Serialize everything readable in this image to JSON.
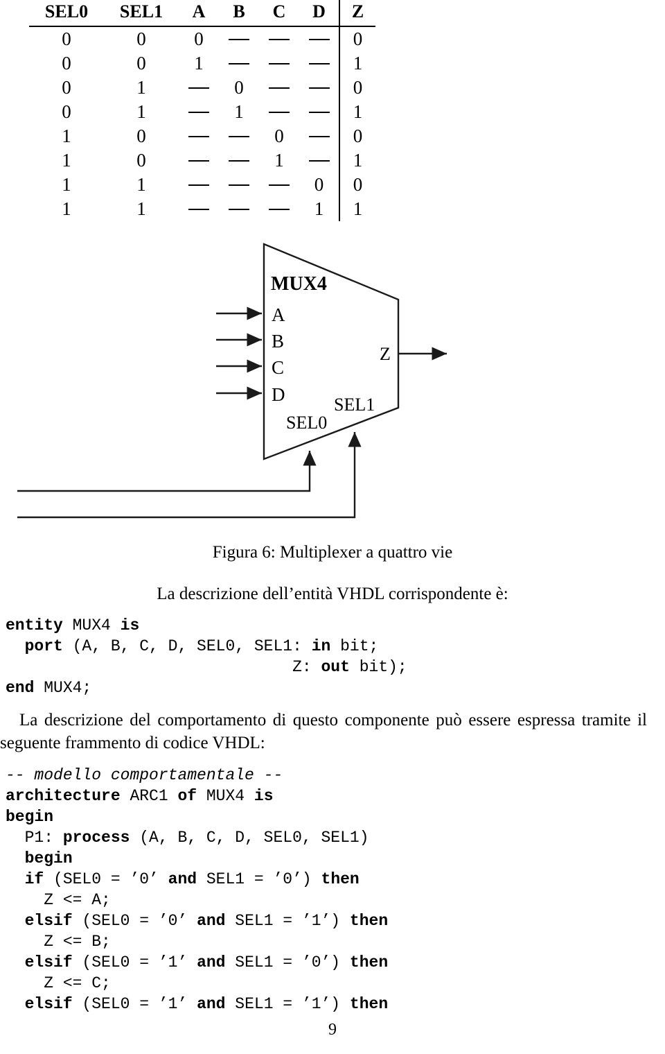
{
  "truth_table": {
    "headers": [
      "SEL0",
      "SEL1",
      "A",
      "B",
      "C",
      "D",
      "Z"
    ],
    "rows": [
      [
        "0",
        "0",
        "0",
        "—",
        "—",
        "—",
        "0"
      ],
      [
        "0",
        "0",
        "1",
        "—",
        "—",
        "—",
        "1"
      ],
      [
        "0",
        "1",
        "—",
        "0",
        "—",
        "—",
        "0"
      ],
      [
        "0",
        "1",
        "—",
        "1",
        "—",
        "—",
        "1"
      ],
      [
        "1",
        "0",
        "—",
        "—",
        "0",
        "—",
        "0"
      ],
      [
        "1",
        "0",
        "—",
        "—",
        "1",
        "—",
        "1"
      ],
      [
        "1",
        "1",
        "—",
        "—",
        "—",
        "0",
        "0"
      ],
      [
        "1",
        "1",
        "—",
        "—",
        "—",
        "1",
        "1"
      ]
    ]
  },
  "figure": {
    "block_label": "MUX4",
    "input_labels": [
      "A",
      "B",
      "C",
      "D"
    ],
    "output_label": "Z",
    "select_labels": [
      "SEL0",
      "SEL1"
    ],
    "caption": "Figura 6: Multiplexer a quattro vie"
  },
  "prose": {
    "entity_intro": "La descrizione dell’entità VHDL corrispondente è:",
    "behaviour_intro": "La descrizione del comportamento di questo componente può essere espressa tramite il seguente frammento di codice VHDL:"
  },
  "entity_code": {
    "line1_kw": "entity",
    "line1_name": " MUX4 ",
    "line1_kw2": "is",
    "line2_indent": "  ",
    "line2_kw": "port",
    "line2_args": " (A, B, C, D, SEL0, SEL1: ",
    "line2_kw2": "in",
    "line2_type": " bit;",
    "line3_indent": "                              ",
    "line3_sig": "Z: ",
    "line3_kw": "out",
    "line3_type": " bit);",
    "line4_kw": "end",
    "line4_name": " MUX4;"
  },
  "arch_code": {
    "comment": "-- modello comportamentale --",
    "l2_kw": "architecture",
    "l2_a": " ARC1 ",
    "l2_kw2": "of",
    "l2_b": " MUX4 ",
    "l2_kw3": "is",
    "l3_kw": "begin",
    "l4_indent": "  ",
    "l4_label": "P1: ",
    "l4_kw": "process",
    "l4_args": " (A, B, C, D, SEL0, SEL1)",
    "l5_indent": "  ",
    "l5_kw": "begin",
    "l6_indent": "  ",
    "l6_kw": "if",
    "l6_a": " (SEL0 = ",
    "l6_kw_and": "and",
    "l6_then": "then",
    "l7": "    Z <= A;",
    "l8_kw": "elsif",
    "l9": "    Z <= B;",
    "l10_kw": "elsif",
    "l11": "    Z <= C;",
    "l12_kw": "elsif",
    "q0": "’0’",
    "q1": "’1’",
    "mid_sel1": " SEL1 = ",
    "close_paren": ") ",
    "space": " "
  },
  "code_lines": {
    "if_00": [
      "if",
      " (SEL0 = ",
      "’0’",
      " ",
      "and",
      " SEL1 = ",
      "’0’",
      ") ",
      "then"
    ],
    "elsif_01": [
      "elsif",
      " (SEL0 = ",
      "’0’",
      " ",
      "and",
      " SEL1 = ",
      "’1’",
      ") ",
      "then"
    ],
    "elsif_10": [
      "elsif",
      " (SEL0 = ",
      "’1’",
      " ",
      "and",
      " SEL1 = ",
      "’0’",
      ") ",
      "then"
    ],
    "elsif_11": [
      "elsif",
      " (SEL0 = ",
      "’1’",
      " ",
      "and",
      " SEL1 = ",
      "’1’",
      ") ",
      "then"
    ],
    "assign_a": "    Z <= A;",
    "assign_b": "    Z <= B;",
    "assign_c": "    Z <= C;"
  },
  "page": {
    "number": "9"
  },
  "colors": {
    "ink": "#000000",
    "paper": "#ffffff"
  }
}
